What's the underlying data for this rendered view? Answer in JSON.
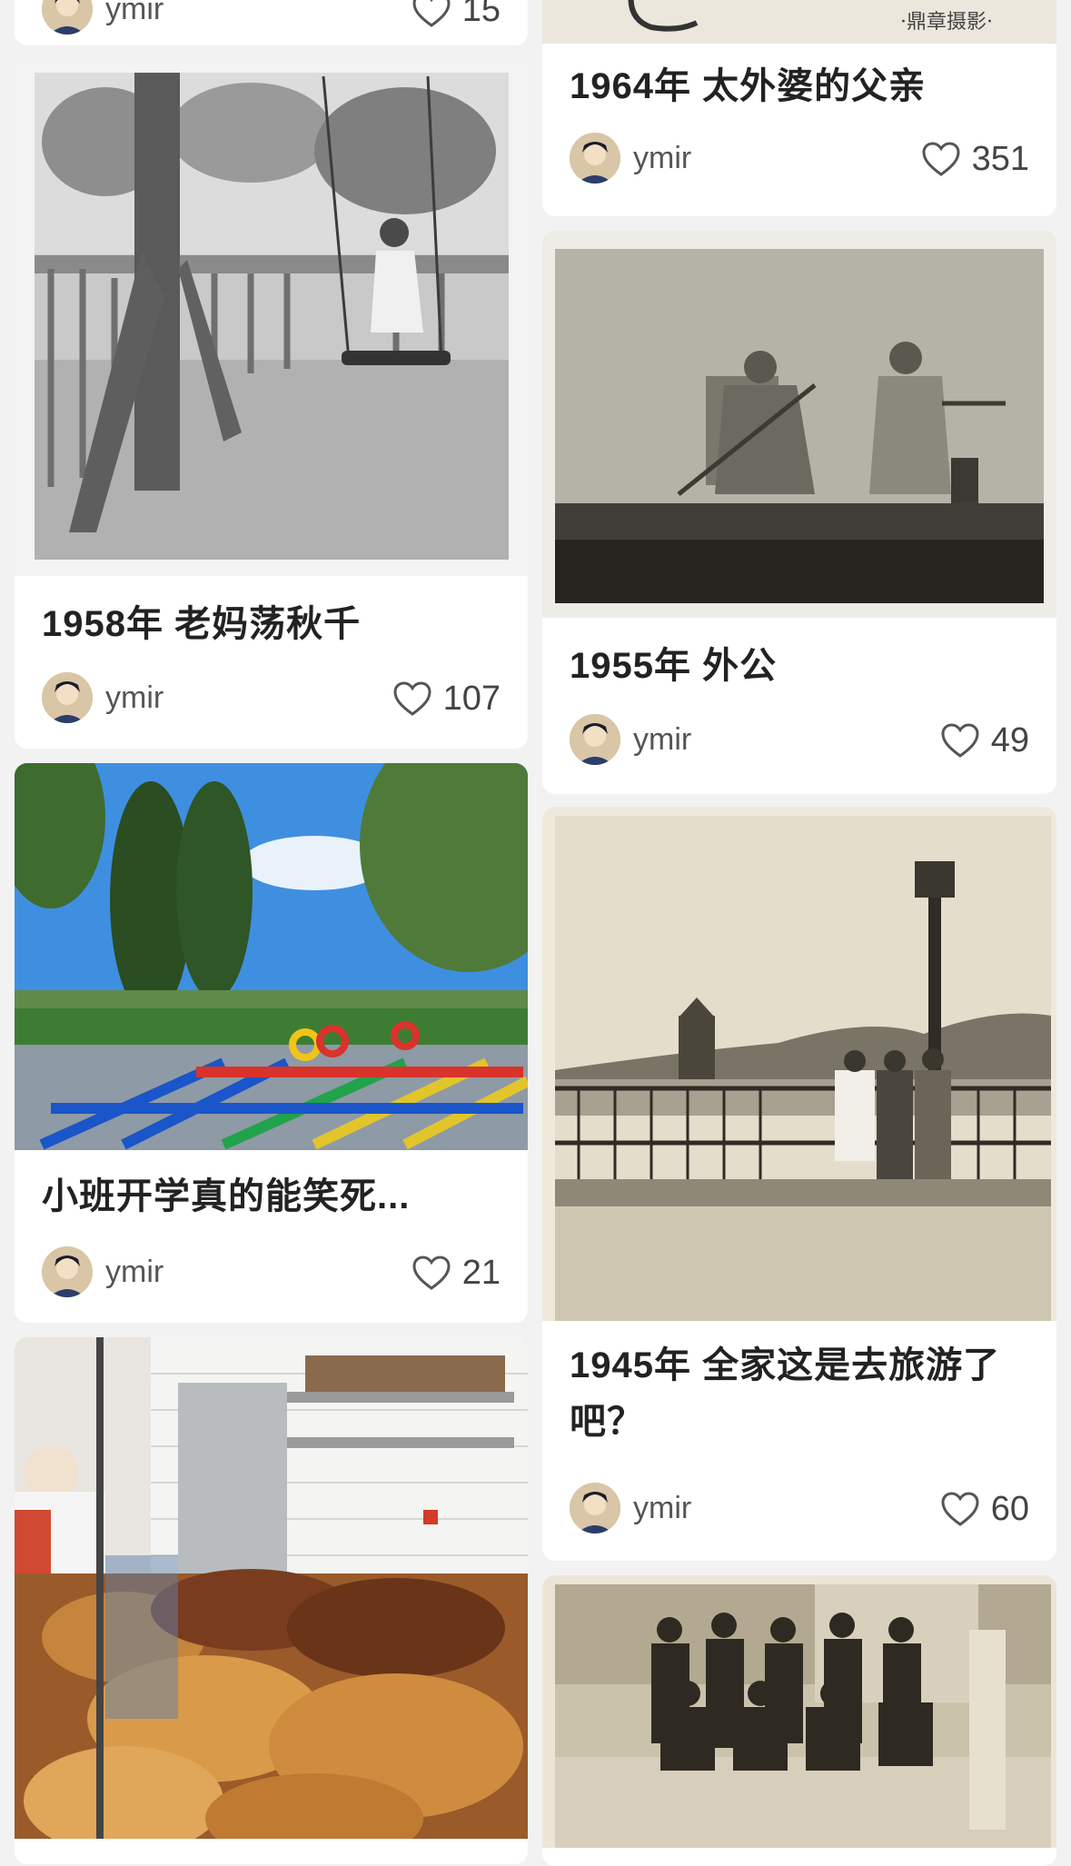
{
  "feed": {
    "cards": [
      {
        "author": "ymir",
        "likes": "15"
      },
      {
        "title": "1958年 老妈荡秋千",
        "author": "ymir",
        "likes": "107"
      },
      {
        "title": "小班开学真的能笑死...",
        "author": "ymir",
        "likes": "21"
      },
      {
        "title": "1964年 太外婆的父亲",
        "author": "ymir",
        "likes": "351",
        "photo_caption": "·鼎章摄影·"
      },
      {
        "title": "1955年 外公",
        "author": "ymir",
        "likes": "49"
      },
      {
        "title": "1945年 全家这是去旅游了吧？",
        "author": "ymir",
        "likes": "60"
      }
    ]
  },
  "icons": {
    "like": "heart-outline-icon",
    "avatar": "user-avatar"
  },
  "colors": {
    "background": "#f2f2f2",
    "card": "#ffffff",
    "title": "#222222",
    "meta": "#555555"
  }
}
